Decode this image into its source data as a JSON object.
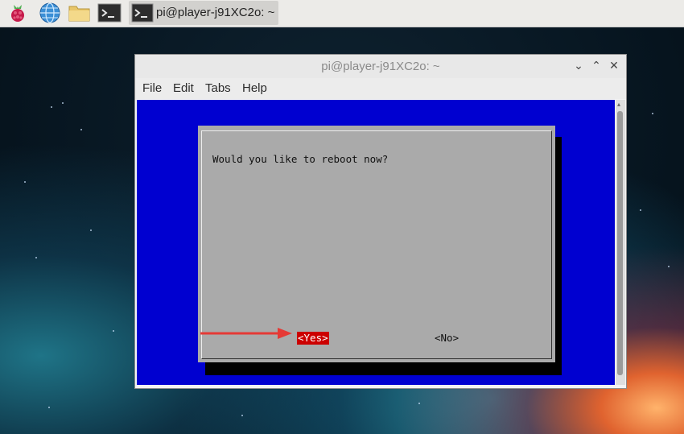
{
  "taskbar": {
    "items": [
      {
        "name": "raspberry-menu",
        "icon": "raspberry-icon"
      },
      {
        "name": "web-browser",
        "icon": "globe-icon"
      },
      {
        "name": "file-manager",
        "icon": "folder-icon"
      },
      {
        "name": "terminal-launcher",
        "icon": "terminal-icon"
      }
    ],
    "active_task": {
      "label": "pi@player-j91XC2o: ~",
      "icon": "terminal-icon"
    }
  },
  "window": {
    "title": "pi@player-j91XC2o: ~",
    "controls": {
      "minimize": "⌄",
      "maximize": "⌃",
      "close": "✕"
    },
    "menu": [
      "File",
      "Edit",
      "Tabs",
      "Help"
    ]
  },
  "dialog": {
    "message": "Would you like to reboot now?",
    "yes_label": "<Yes>",
    "no_label": "<No>",
    "selected": "yes"
  },
  "colors": {
    "terminal_bg": "#0000d0",
    "dialog_bg": "#aaaaaa",
    "selected_button": "#cc0000",
    "arrow": "#e53935"
  },
  "annotations": {
    "arrow_target": "yes-button",
    "arrow_icon": "arrow-right-icon"
  }
}
